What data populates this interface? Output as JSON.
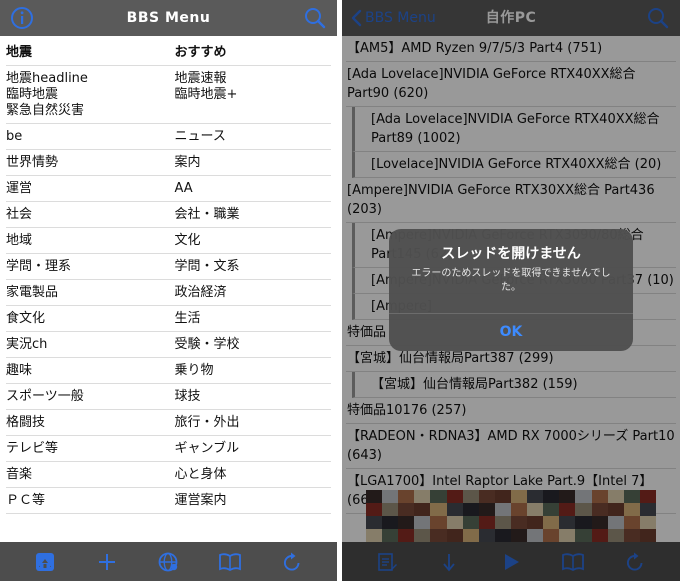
{
  "left": {
    "nav": {
      "title": "BBS Menu",
      "info_icon": "info-icon",
      "search_icon": "search-icon"
    },
    "menu_rows": [
      [
        "地震",
        "おすすめ"
      ],
      [
        "地震headline\n臨時地震\n緊急自然災害",
        "地震速報\n臨時地震+"
      ],
      [
        "be",
        "ニュース"
      ],
      [
        "世界情勢",
        "案内"
      ],
      [
        "運営",
        "AA"
      ],
      [
        "社会",
        "会社・職業"
      ],
      [
        "地域",
        "文化"
      ],
      [
        "学問・理系",
        "学問・文系"
      ],
      [
        "家電製品",
        "政治経済"
      ],
      [
        "食文化",
        "生活"
      ],
      [
        "実況ch",
        "受験・学校"
      ],
      [
        "趣味",
        "乗り物"
      ],
      [
        "スポーツ一般",
        "球技"
      ],
      [
        "格闘技",
        "旅行・外出"
      ],
      [
        "テレビ等",
        "ギャンブル"
      ],
      [
        "音楽",
        "心と身体"
      ],
      [
        "ＰＣ等",
        "運営案内"
      ]
    ],
    "toolbar": [
      "home-icon",
      "plus-icon",
      "globe-icon",
      "book-icon",
      "refresh-icon"
    ]
  },
  "right": {
    "nav": {
      "back_label": "BBS Menu",
      "title": "自作PC",
      "search_icon": "search-icon"
    },
    "threads": [
      {
        "text": "【AM5】AMD Ryzen 9/7/5/3 Part4 (751)",
        "sub": false
      },
      {
        "text": "[Ada Lovelace]NVIDIA GeForce RTX40XX総合 Part90 (620)",
        "sub": false
      },
      {
        "text": "[Ada Lovelace]NVIDIA GeForce RTX40XX総合 Part89 (1002)",
        "sub": true
      },
      {
        "text": "[Lovelace]NVIDIA GeForce RTX40XX総合 (20)",
        "sub": true
      },
      {
        "text": "[Ampere]NVIDIA GeForce RTX30XX総合 Part436 (203)",
        "sub": false
      },
      {
        "text": "[Ampere]NVIDIA GeForce RTX3090/80総合 Part145 (62)",
        "sub": true
      },
      {
        "text": "[Ampere]NVIDIA GeForce RTX3060 Part37 (10)",
        "sub": true
      },
      {
        "text": "[Ampere]",
        "sub": true
      },
      {
        "text": "特価品",
        "sub": false
      },
      {
        "text": "【宮城】仙台情報局Part387 (299)",
        "sub": false
      },
      {
        "text": "【宮城】仙台情報局Part382 (159)",
        "sub": true
      },
      {
        "text": "特価品10176 (257)",
        "sub": false
      },
      {
        "text": "【RADEON・RDNA3】AMD RX 7000シリーズ Part10 (643)",
        "sub": false
      },
      {
        "text": "【LGA1700】Intel Raptor Lake Part.9【Intel 7】(667)",
        "sub": false
      }
    ],
    "alert": {
      "title": "スレッドを開けません",
      "message": "エラーのためスレッドを取得できませんでした。",
      "ok_label": "OK"
    },
    "toolbar": [
      "compose-icon",
      "arrow-down-icon",
      "play-icon",
      "book-icon",
      "refresh-icon"
    ]
  },
  "colors": {
    "navbar": "#5a5a5a",
    "toolbar": "#4d4d4d",
    "accent_blue": "#2f6fe0",
    "alert_ok": "#3d8bff"
  }
}
